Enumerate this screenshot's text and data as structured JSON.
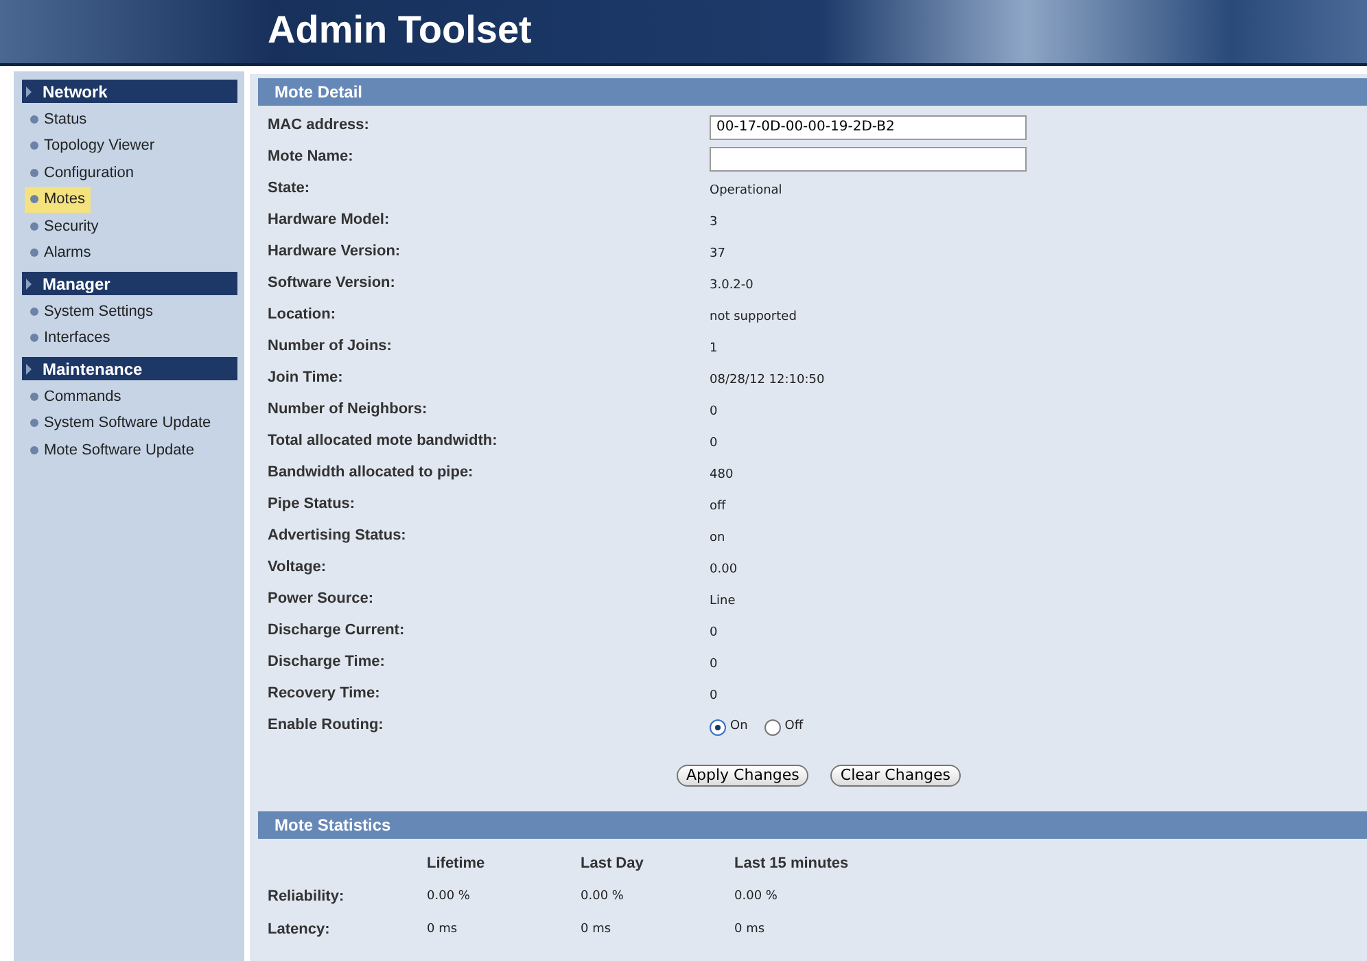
{
  "header": {
    "title": "Admin Toolset"
  },
  "sidebar": {
    "sections": [
      {
        "title": "Network",
        "items": [
          {
            "label": "Status",
            "selected": false
          },
          {
            "label": "Topology Viewer",
            "selected": false
          },
          {
            "label": "Configuration",
            "selected": false
          },
          {
            "label": "Motes",
            "selected": true
          },
          {
            "label": "Security",
            "selected": false
          },
          {
            "label": "Alarms",
            "selected": false
          }
        ]
      },
      {
        "title": "Manager",
        "items": [
          {
            "label": "System Settings",
            "selected": false
          },
          {
            "label": "Interfaces",
            "selected": false
          }
        ]
      },
      {
        "title": "Maintenance",
        "items": [
          {
            "label": "Commands",
            "selected": false
          },
          {
            "label": "System Software Update",
            "selected": false
          },
          {
            "label": "Mote Software Update",
            "selected": false
          }
        ]
      }
    ]
  },
  "mote_detail": {
    "title": "Mote Detail",
    "fields": [
      {
        "label": "MAC address:",
        "kind": "input",
        "value": "00-17-0D-00-00-19-2D-B2"
      },
      {
        "label": "Mote Name:",
        "kind": "input"
      },
      {
        "label": "State:",
        "kind": "text",
        "value": "Operational"
      },
      {
        "label": "Hardware Model:",
        "kind": "text",
        "value": "3"
      },
      {
        "label": "Hardware Version:",
        "kind": "text",
        "value": "37"
      },
      {
        "label": "Software Version:",
        "kind": "text",
        "value": "3.0.2-0"
      },
      {
        "label": "Location:",
        "kind": "text",
        "value": "not supported"
      },
      {
        "label": "Number of Joins:",
        "kind": "text",
        "value": "1"
      },
      {
        "label": "Join Time:",
        "kind": "text",
        "value": "08/28/12 12:10:50"
      },
      {
        "label": "Number of Neighbors:",
        "kind": "text",
        "value": "0"
      },
      {
        "label": "Total allocated mote bandwidth:",
        "kind": "text",
        "value": "0"
      },
      {
        "label": "Bandwidth allocated to pipe:",
        "kind": "text",
        "value": "480"
      },
      {
        "label": "Pipe Status:",
        "kind": "text",
        "value": "off"
      },
      {
        "label": "Advertising Status:",
        "kind": "text",
        "value": "on"
      },
      {
        "label": "Voltage:",
        "kind": "text",
        "value": "0.00"
      },
      {
        "label": "Power Source:",
        "kind": "text",
        "value": "Line"
      },
      {
        "label": "Discharge Current:",
        "kind": "text",
        "value": "0"
      },
      {
        "label": "Discharge Time:",
        "kind": "text",
        "value": "0"
      },
      {
        "label": "Recovery Time:",
        "kind": "text",
        "value": "0"
      },
      {
        "label": "Enable Routing:",
        "kind": "radio",
        "options": [
          {
            "label": "On",
            "selected": true
          },
          {
            "label": "Off",
            "selected": false
          }
        ]
      }
    ],
    "buttons": [
      "Apply Changes",
      "Clear Changes"
    ]
  },
  "mote_statistics": {
    "title": "Mote Statistics",
    "columns": [
      "Lifetime",
      "Last Day",
      "Last 15 minutes"
    ],
    "rows": [
      {
        "label": "Reliability:",
        "values": [
          "0.00 %",
          "0.00 %",
          "0.00 %"
        ]
      },
      {
        "label": "Latency:",
        "values": [
          "0 ms",
          "0 ms",
          "0 ms"
        ]
      }
    ]
  }
}
